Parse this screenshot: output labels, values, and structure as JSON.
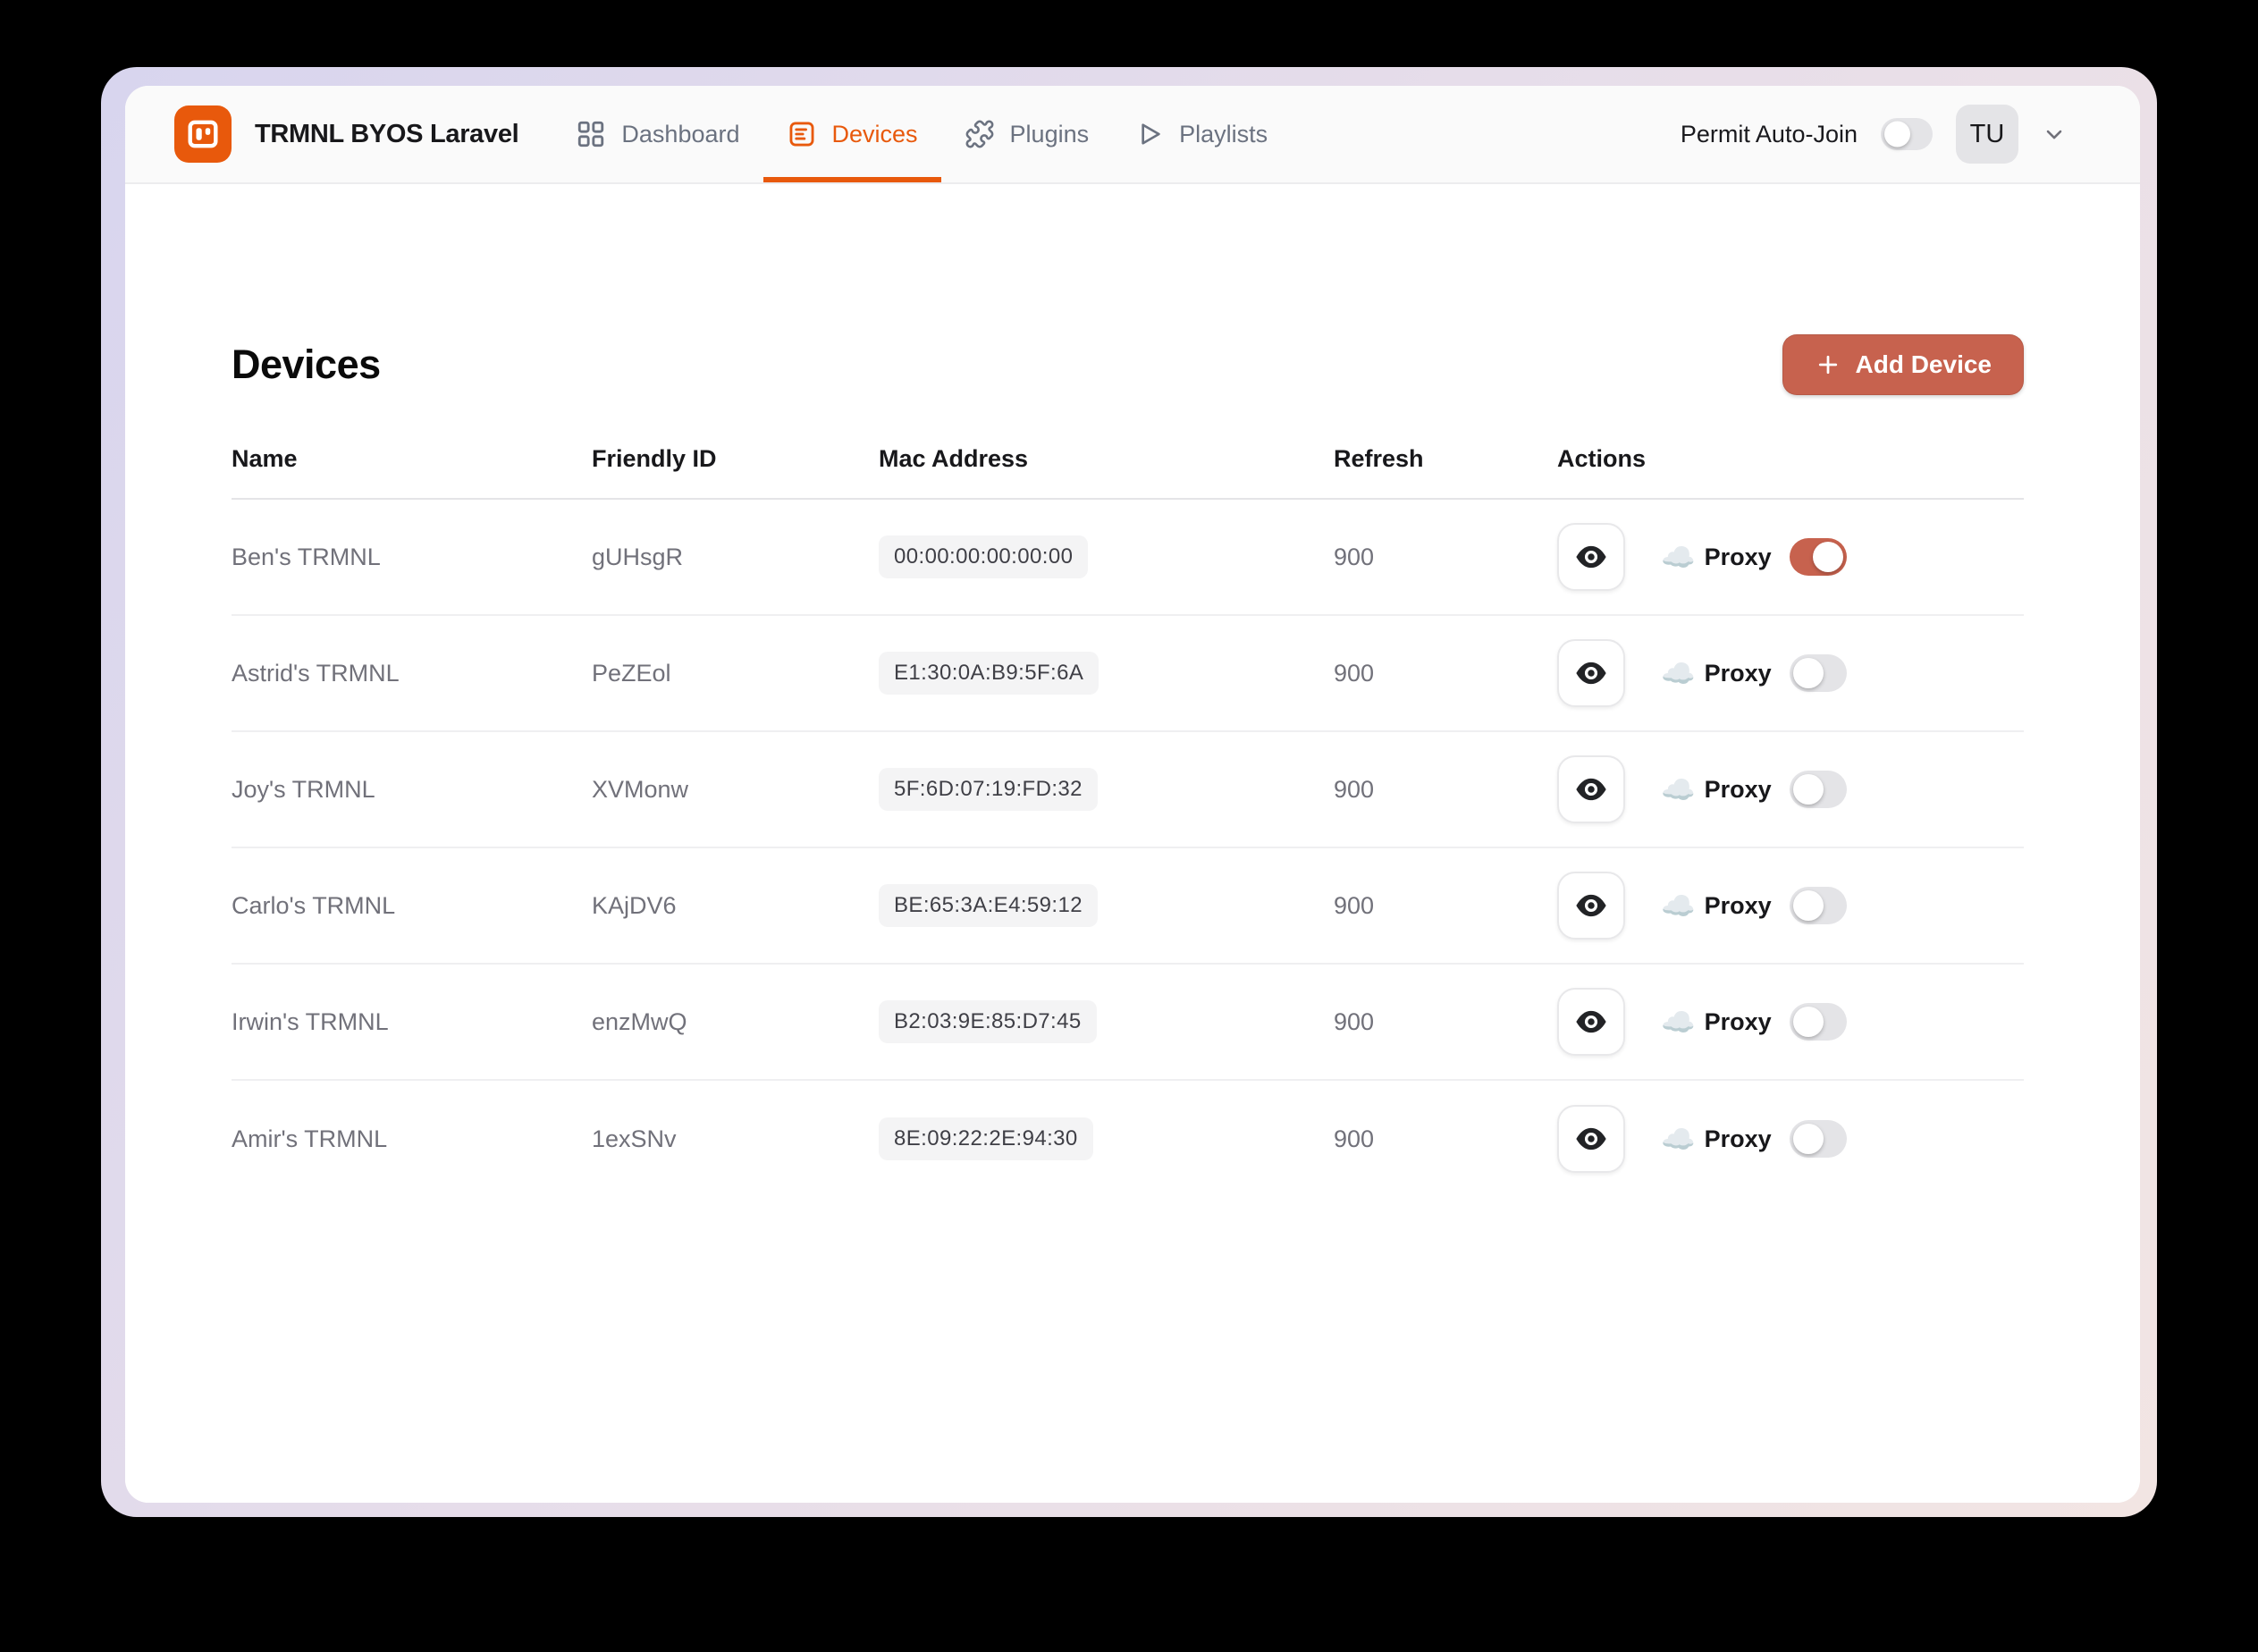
{
  "window": {
    "header": {
      "app_title": "TRMNL BYOS Laravel",
      "nav_items": [
        {
          "label": "Dashboard",
          "icon": "dashboard-grid-icon",
          "active": false
        },
        {
          "label": "Devices",
          "icon": "devices-list-icon",
          "active": true
        },
        {
          "label": "Plugins",
          "icon": "plugins-puzzle-icon",
          "active": false
        },
        {
          "label": "Playlists",
          "icon": "playlists-play-icon",
          "active": false
        }
      ],
      "auto_join_label": "Permit Auto-Join",
      "auto_join_enabled": false,
      "user_initials": "TU"
    },
    "page": {
      "title": "Devices",
      "add_device_label": "Add Device"
    },
    "table": {
      "columns": [
        "Name",
        "Friendly ID",
        "Mac Address",
        "Refresh",
        "Actions"
      ],
      "proxy_label": "Proxy",
      "rows": [
        {
          "name": "Ben's TRMNL",
          "friendly_id": "gUHsgR",
          "mac": "00:00:00:00:00:00",
          "refresh": "900",
          "proxy_enabled": true
        },
        {
          "name": "Astrid's TRMNL",
          "friendly_id": "PeZEol",
          "mac": "E1:30:0A:B9:5F:6A",
          "refresh": "900",
          "proxy_enabled": false
        },
        {
          "name": "Joy's TRMNL",
          "friendly_id": "XVMonw",
          "mac": "5F:6D:07:19:FD:32",
          "refresh": "900",
          "proxy_enabled": false
        },
        {
          "name": "Carlo's TRMNL",
          "friendly_id": "KAjDV6",
          "mac": "BE:65:3A:E4:59:12",
          "refresh": "900",
          "proxy_enabled": false
        },
        {
          "name": "Irwin's TRMNL",
          "friendly_id": "enzMwQ",
          "mac": "B2:03:9E:85:D7:45",
          "refresh": "900",
          "proxy_enabled": false
        },
        {
          "name": "Amir's TRMNL",
          "friendly_id": "1exSNv",
          "mac": "8E:09:22:2E:94:30",
          "refresh": "900",
          "proxy_enabled": false
        }
      ]
    },
    "icons": {
      "cloud": "☁️",
      "logo": "trmnl-device-logo",
      "eye": "eye-icon",
      "plus": "plus-icon",
      "chevron": "chevron-down-icon"
    },
    "colors": {
      "brand_orange": "#E8590C",
      "accent_terracotta": "#C7624E",
      "toggle_off_gray": "#E4E4E7",
      "header_bg": "#FAFAFA",
      "badge_bg": "#F4F4F5"
    }
  }
}
